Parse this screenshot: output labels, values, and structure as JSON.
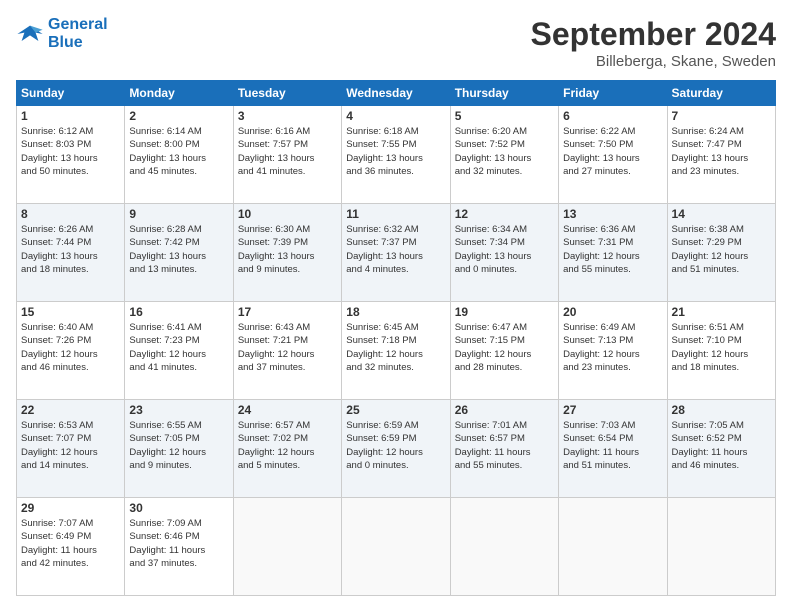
{
  "logo": {
    "line1": "General",
    "line2": "Blue"
  },
  "title": "September 2024",
  "subtitle": "Billeberga, Skane, Sweden",
  "weekdays": [
    "Sunday",
    "Monday",
    "Tuesday",
    "Wednesday",
    "Thursday",
    "Friday",
    "Saturday"
  ],
  "weeks": [
    [
      {
        "day": "1",
        "info": "Sunrise: 6:12 AM\nSunset: 8:03 PM\nDaylight: 13 hours\nand 50 minutes."
      },
      {
        "day": "2",
        "info": "Sunrise: 6:14 AM\nSunset: 8:00 PM\nDaylight: 13 hours\nand 45 minutes."
      },
      {
        "day": "3",
        "info": "Sunrise: 6:16 AM\nSunset: 7:57 PM\nDaylight: 13 hours\nand 41 minutes."
      },
      {
        "day": "4",
        "info": "Sunrise: 6:18 AM\nSunset: 7:55 PM\nDaylight: 13 hours\nand 36 minutes."
      },
      {
        "day": "5",
        "info": "Sunrise: 6:20 AM\nSunset: 7:52 PM\nDaylight: 13 hours\nand 32 minutes."
      },
      {
        "day": "6",
        "info": "Sunrise: 6:22 AM\nSunset: 7:50 PM\nDaylight: 13 hours\nand 27 minutes."
      },
      {
        "day": "7",
        "info": "Sunrise: 6:24 AM\nSunset: 7:47 PM\nDaylight: 13 hours\nand 23 minutes."
      }
    ],
    [
      {
        "day": "8",
        "info": "Sunrise: 6:26 AM\nSunset: 7:44 PM\nDaylight: 13 hours\nand 18 minutes."
      },
      {
        "day": "9",
        "info": "Sunrise: 6:28 AM\nSunset: 7:42 PM\nDaylight: 13 hours\nand 13 minutes."
      },
      {
        "day": "10",
        "info": "Sunrise: 6:30 AM\nSunset: 7:39 PM\nDaylight: 13 hours\nand 9 minutes."
      },
      {
        "day": "11",
        "info": "Sunrise: 6:32 AM\nSunset: 7:37 PM\nDaylight: 13 hours\nand 4 minutes."
      },
      {
        "day": "12",
        "info": "Sunrise: 6:34 AM\nSunset: 7:34 PM\nDaylight: 13 hours\nand 0 minutes."
      },
      {
        "day": "13",
        "info": "Sunrise: 6:36 AM\nSunset: 7:31 PM\nDaylight: 12 hours\nand 55 minutes."
      },
      {
        "day": "14",
        "info": "Sunrise: 6:38 AM\nSunset: 7:29 PM\nDaylight: 12 hours\nand 51 minutes."
      }
    ],
    [
      {
        "day": "15",
        "info": "Sunrise: 6:40 AM\nSunset: 7:26 PM\nDaylight: 12 hours\nand 46 minutes."
      },
      {
        "day": "16",
        "info": "Sunrise: 6:41 AM\nSunset: 7:23 PM\nDaylight: 12 hours\nand 41 minutes."
      },
      {
        "day": "17",
        "info": "Sunrise: 6:43 AM\nSunset: 7:21 PM\nDaylight: 12 hours\nand 37 minutes."
      },
      {
        "day": "18",
        "info": "Sunrise: 6:45 AM\nSunset: 7:18 PM\nDaylight: 12 hours\nand 32 minutes."
      },
      {
        "day": "19",
        "info": "Sunrise: 6:47 AM\nSunset: 7:15 PM\nDaylight: 12 hours\nand 28 minutes."
      },
      {
        "day": "20",
        "info": "Sunrise: 6:49 AM\nSunset: 7:13 PM\nDaylight: 12 hours\nand 23 minutes."
      },
      {
        "day": "21",
        "info": "Sunrise: 6:51 AM\nSunset: 7:10 PM\nDaylight: 12 hours\nand 18 minutes."
      }
    ],
    [
      {
        "day": "22",
        "info": "Sunrise: 6:53 AM\nSunset: 7:07 PM\nDaylight: 12 hours\nand 14 minutes."
      },
      {
        "day": "23",
        "info": "Sunrise: 6:55 AM\nSunset: 7:05 PM\nDaylight: 12 hours\nand 9 minutes."
      },
      {
        "day": "24",
        "info": "Sunrise: 6:57 AM\nSunset: 7:02 PM\nDaylight: 12 hours\nand 5 minutes."
      },
      {
        "day": "25",
        "info": "Sunrise: 6:59 AM\nSunset: 6:59 PM\nDaylight: 12 hours\nand 0 minutes."
      },
      {
        "day": "26",
        "info": "Sunrise: 7:01 AM\nSunset: 6:57 PM\nDaylight: 11 hours\nand 55 minutes."
      },
      {
        "day": "27",
        "info": "Sunrise: 7:03 AM\nSunset: 6:54 PM\nDaylight: 11 hours\nand 51 minutes."
      },
      {
        "day": "28",
        "info": "Sunrise: 7:05 AM\nSunset: 6:52 PM\nDaylight: 11 hours\nand 46 minutes."
      }
    ],
    [
      {
        "day": "29",
        "info": "Sunrise: 7:07 AM\nSunset: 6:49 PM\nDaylight: 11 hours\nand 42 minutes."
      },
      {
        "day": "30",
        "info": "Sunrise: 7:09 AM\nSunset: 6:46 PM\nDaylight: 11 hours\nand 37 minutes."
      },
      {
        "day": "",
        "info": ""
      },
      {
        "day": "",
        "info": ""
      },
      {
        "day": "",
        "info": ""
      },
      {
        "day": "",
        "info": ""
      },
      {
        "day": "",
        "info": ""
      }
    ]
  ]
}
